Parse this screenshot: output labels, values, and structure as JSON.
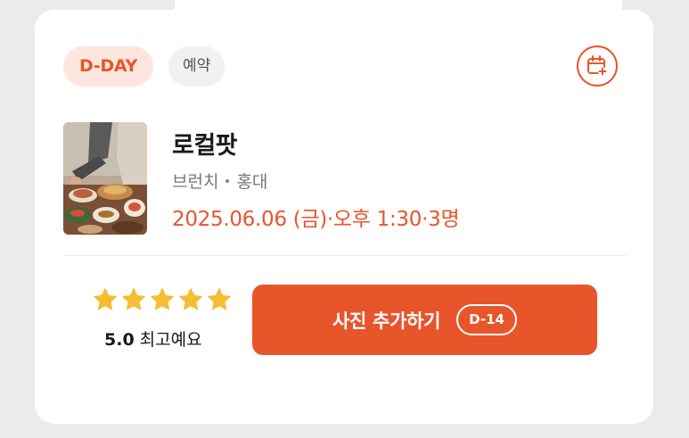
{
  "badges": {
    "dday": "D-DAY",
    "status": "예약"
  },
  "icons": {
    "calendar": "calendar-add-icon",
    "star": "star-icon"
  },
  "colors": {
    "accent": "#e8552b",
    "accent_soft": "#fde6dd",
    "star": "#f6bd33"
  },
  "store": {
    "name": "로컬팟",
    "category": "브런치",
    "area": "홍대",
    "reservation": "2025.06.06 (금)·오후 1:30·3명",
    "thumbnail": "brunch-table-photo"
  },
  "review": {
    "stars": 5,
    "score": "5.0",
    "label": "최고예요"
  },
  "action": {
    "label": "사진 추가하기",
    "dday": "D-14"
  }
}
